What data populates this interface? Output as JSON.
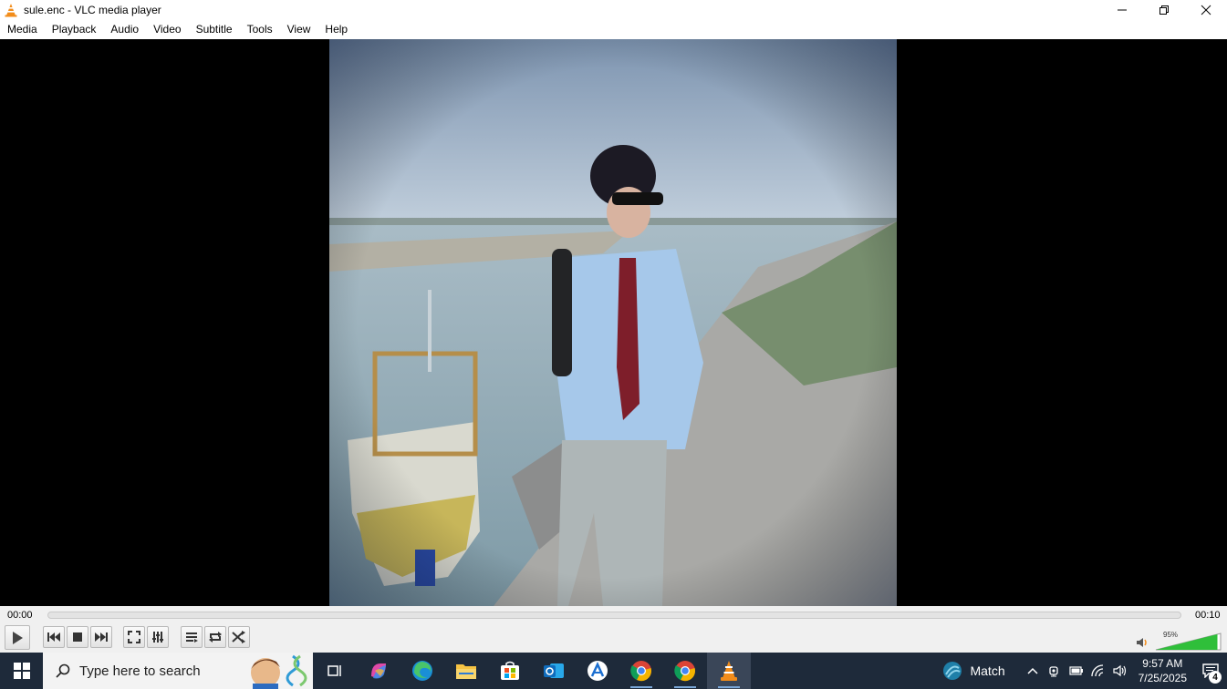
{
  "window": {
    "title": "sule.enc - VLC media player",
    "icon": "vlc-cone-icon",
    "controls": [
      "minimize-icon",
      "restore-icon",
      "close-icon"
    ]
  },
  "menu": [
    "Media",
    "Playback",
    "Audio",
    "Video",
    "Subtitle",
    "Tools",
    "View",
    "Help"
  ],
  "player": {
    "elapsed": "00:00",
    "total": "00:10",
    "progress": 0,
    "volume_label": "95%",
    "volume": 0.95,
    "buttons": [
      "play-icon",
      "previous-icon",
      "stop-icon",
      "next-icon",
      "fullscreen-icon",
      "extended-settings-icon",
      "playlist-icon",
      "loop-icon",
      "shuffle-icon"
    ]
  },
  "taskbar": {
    "search_placeholder": "Type here to search",
    "weather_label": "Match",
    "time": "9:57 AM",
    "date": "7/25/2025",
    "notification_count": "4",
    "apps": [
      "task-view-icon",
      "copilot-icon",
      "edge-icon",
      "file-explorer-icon",
      "store-icon",
      "outlook-icon",
      "app-icon",
      "chrome-icon",
      "chrome-icon",
      "vlc-icon"
    ]
  },
  "colors": {
    "accent_orange": "#f28c1a",
    "taskbar_bg": "#1e2a3a",
    "volume_green": "#2fbf3a"
  }
}
